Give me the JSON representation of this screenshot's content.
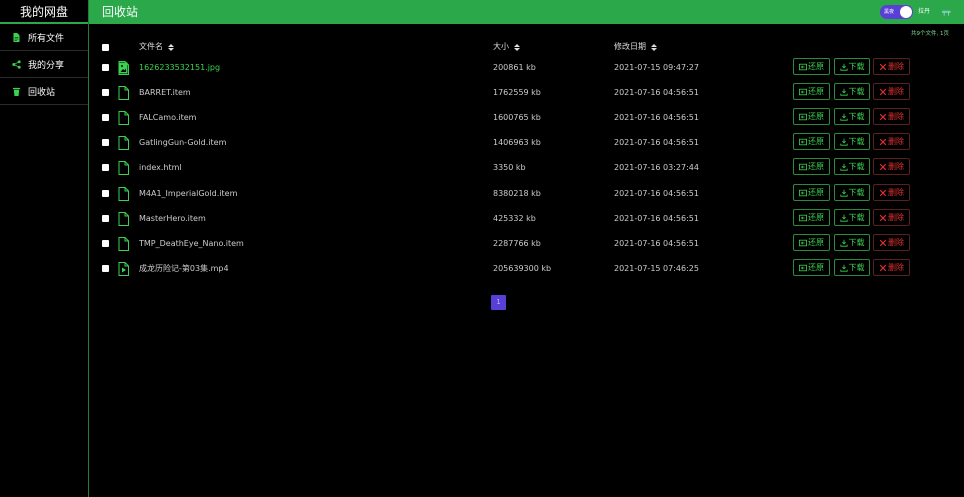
{
  "app": {
    "brand": "我的网盘"
  },
  "sidebar": {
    "items": [
      {
        "label": "所有文件",
        "icon": "file-icon"
      },
      {
        "label": "我的分享",
        "icon": "share-icon"
      },
      {
        "label": "回收站",
        "icon": "trash-icon"
      }
    ]
  },
  "header": {
    "title": "回收站",
    "toggle_text": "黑夜",
    "toggle_label": "拉丹",
    "menu_label": "╤╤",
    "color": "#2aa84a"
  },
  "summary": "共9个文件, 1页",
  "table": {
    "headers": {
      "name": "文件名",
      "size": "大小",
      "date": "修改日期"
    },
    "rows": [
      {
        "name": "1626233532151.jpg",
        "size": "200861 kb",
        "date": "2021-07-15 09:47:27",
        "type": "image",
        "highlight": true
      },
      {
        "name": "BARRET.item",
        "size": "1762559 kb",
        "date": "2021-07-16 04:56:51",
        "type": "file",
        "highlight": false
      },
      {
        "name": "FALCamo.item",
        "size": "1600765 kb",
        "date": "2021-07-16 04:56:51",
        "type": "file",
        "highlight": false
      },
      {
        "name": "GatlingGun-Gold.item",
        "size": "1406963 kb",
        "date": "2021-07-16 04:56:51",
        "type": "file",
        "highlight": false
      },
      {
        "name": "index.html",
        "size": "3350 kb",
        "date": "2021-07-16 03:27:44",
        "type": "file",
        "highlight": false
      },
      {
        "name": "M4A1_ImperialGold.item",
        "size": "8380218 kb",
        "date": "2021-07-16 04:56:51",
        "type": "file",
        "highlight": false
      },
      {
        "name": "MasterHero.item",
        "size": "425332 kb",
        "date": "2021-07-16 04:56:51",
        "type": "file",
        "highlight": false
      },
      {
        "name": "TMP_DeathEye_Nano.item",
        "size": "2287766 kb",
        "date": "2021-07-16 04:56:51",
        "type": "file",
        "highlight": false
      },
      {
        "name": "成龙历险记-第03集.mp4",
        "size": "205639300 kb",
        "date": "2021-07-15 07:46:25",
        "type": "video",
        "highlight": false
      }
    ],
    "actions": {
      "restore": "还原",
      "download": "下载",
      "delete": "删除"
    }
  },
  "pagination": {
    "current": "1"
  },
  "colors": {
    "accent": "#2aa84a",
    "link": "#3ad24e",
    "danger": "#e03030",
    "page": "#5a3fd6"
  }
}
